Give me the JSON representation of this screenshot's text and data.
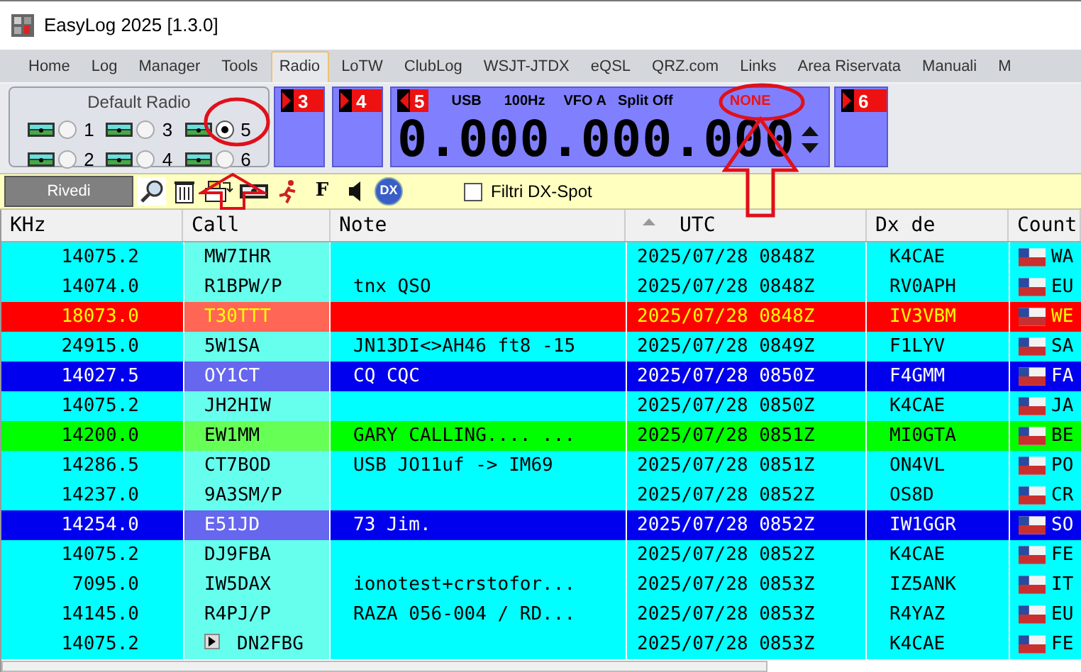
{
  "window": {
    "title": "EasyLog 2025 [1.3.0]"
  },
  "menu": [
    {
      "label": "Home",
      "selected": false
    },
    {
      "label": "Log",
      "selected": false
    },
    {
      "label": "Manager",
      "selected": false
    },
    {
      "label": "Tools",
      "selected": false
    },
    {
      "label": "Radio",
      "selected": true
    },
    {
      "label": "LoTW",
      "selected": false
    },
    {
      "label": "ClubLog",
      "selected": false
    },
    {
      "label": "WSJT-JTDX",
      "selected": false
    },
    {
      "label": "eQSL",
      "selected": false
    },
    {
      "label": "QRZ.com",
      "selected": false
    },
    {
      "label": "Links",
      "selected": false
    },
    {
      "label": "Area Riservata",
      "selected": false
    },
    {
      "label": "Manuali",
      "selected": false
    },
    {
      "label": "M",
      "selected": false
    }
  ],
  "default_radio": {
    "title": "Default Radio",
    "options": [
      {
        "label": "1",
        "selected": false
      },
      {
        "label": "2",
        "selected": false
      },
      {
        "label": "3",
        "selected": false
      },
      {
        "label": "4",
        "selected": false
      },
      {
        "label": "5",
        "selected": true
      },
      {
        "label": "6",
        "selected": false
      }
    ]
  },
  "radio_panels": [
    {
      "number": "3"
    },
    {
      "number": "4"
    },
    {
      "number": "5",
      "mode": "USB",
      "step": "100Hz",
      "vfo": "VFO A",
      "split": "Split Off",
      "status": "NONE",
      "frequency": "0.000.000.000"
    },
    {
      "number": "6"
    }
  ],
  "toolbar": {
    "review_button": "Rivedi",
    "f_button": "F",
    "dx_button": "DX",
    "filter": {
      "label": "Filtri DX-Spot",
      "checked": false
    }
  },
  "table": {
    "columns": [
      "KHz",
      "Call",
      "Note",
      "UTC",
      "Dx de",
      "Count"
    ],
    "rows": [
      {
        "kind": "normal",
        "khz": "14075.2",
        "call": "MW7IHR",
        "note": "",
        "utc": "2025/07/28 0848Z",
        "dx_de": "K4CAE",
        "country": "WA",
        "play_button": false
      },
      {
        "kind": "normal",
        "khz": "14074.0",
        "call": "R1BPW/P",
        "note": "tnx QSO",
        "utc": "2025/07/28 0848Z",
        "dx_de": "RV0APH",
        "country": "EU",
        "play_button": false
      },
      {
        "kind": "red",
        "khz": "18073.0",
        "call": "T30TTT",
        "note": "",
        "utc": "2025/07/28 0848Z",
        "dx_de": "IV3VBM",
        "country": "WE",
        "play_button": false
      },
      {
        "kind": "normal",
        "khz": "24915.0",
        "call": "5W1SA",
        "note": "JN13DI<>AH46 ft8 -15",
        "utc": "2025/07/28 0849Z",
        "dx_de": "F1LYV",
        "country": "SA",
        "play_button": false
      },
      {
        "kind": "blue",
        "khz": "14027.5",
        "call": "OY1CT",
        "note": "CQ CQC",
        "utc": "2025/07/28 0850Z",
        "dx_de": "F4GMM",
        "country": "FA",
        "play_button": false
      },
      {
        "kind": "normal",
        "khz": "14075.2",
        "call": "JH2HIW",
        "note": "",
        "utc": "2025/07/28 0850Z",
        "dx_de": "K4CAE",
        "country": "JA",
        "play_button": false
      },
      {
        "kind": "green",
        "khz": "14200.0",
        "call": "EW1MM",
        "note": "GARY CALLING.... ...",
        "utc": "2025/07/28 0851Z",
        "dx_de": "MI0GTA",
        "country": "BE",
        "play_button": false
      },
      {
        "kind": "normal",
        "khz": "14286.5",
        "call": "CT7BOD",
        "note": "USB JO11uf -> IM69",
        "utc": "2025/07/28 0851Z",
        "dx_de": "ON4VL",
        "country": "PO",
        "play_button": false
      },
      {
        "kind": "normal",
        "khz": "14237.0",
        "call": "9A3SM/P",
        "note": "",
        "utc": "2025/07/28 0852Z",
        "dx_de": "OS8D",
        "country": "CR",
        "play_button": false
      },
      {
        "kind": "blue",
        "khz": "14254.0",
        "call": "E51JD",
        "note": "73 Jim.",
        "utc": "2025/07/28 0852Z",
        "dx_de": "IW1GGR",
        "country": "SO",
        "play_button": false
      },
      {
        "kind": "normal",
        "khz": "14075.2",
        "call": "DJ9FBA",
        "note": "",
        "utc": "2025/07/28 0852Z",
        "dx_de": "K4CAE",
        "country": "FE",
        "play_button": false
      },
      {
        "kind": "normal",
        "khz": "7095.0",
        "call": "IW5DAX",
        "note": "ionotest+crstofor...",
        "utc": "2025/07/28 0853Z",
        "dx_de": "IZ5ANK",
        "country": "IT",
        "play_button": false
      },
      {
        "kind": "normal",
        "khz": "14145.0",
        "call": "R4PJ/P",
        "note": "RAZA 056-004 / RD...",
        "utc": "2025/07/28 0853Z",
        "dx_de": "R4YAZ",
        "country": "EU",
        "play_button": false
      },
      {
        "kind": "normal",
        "khz": "14075.2",
        "call": "DN2FBG",
        "note": "",
        "utc": "2025/07/28 0853Z",
        "dx_de": "K4CAE",
        "country": "FE",
        "play_button": true
      }
    ]
  }
}
